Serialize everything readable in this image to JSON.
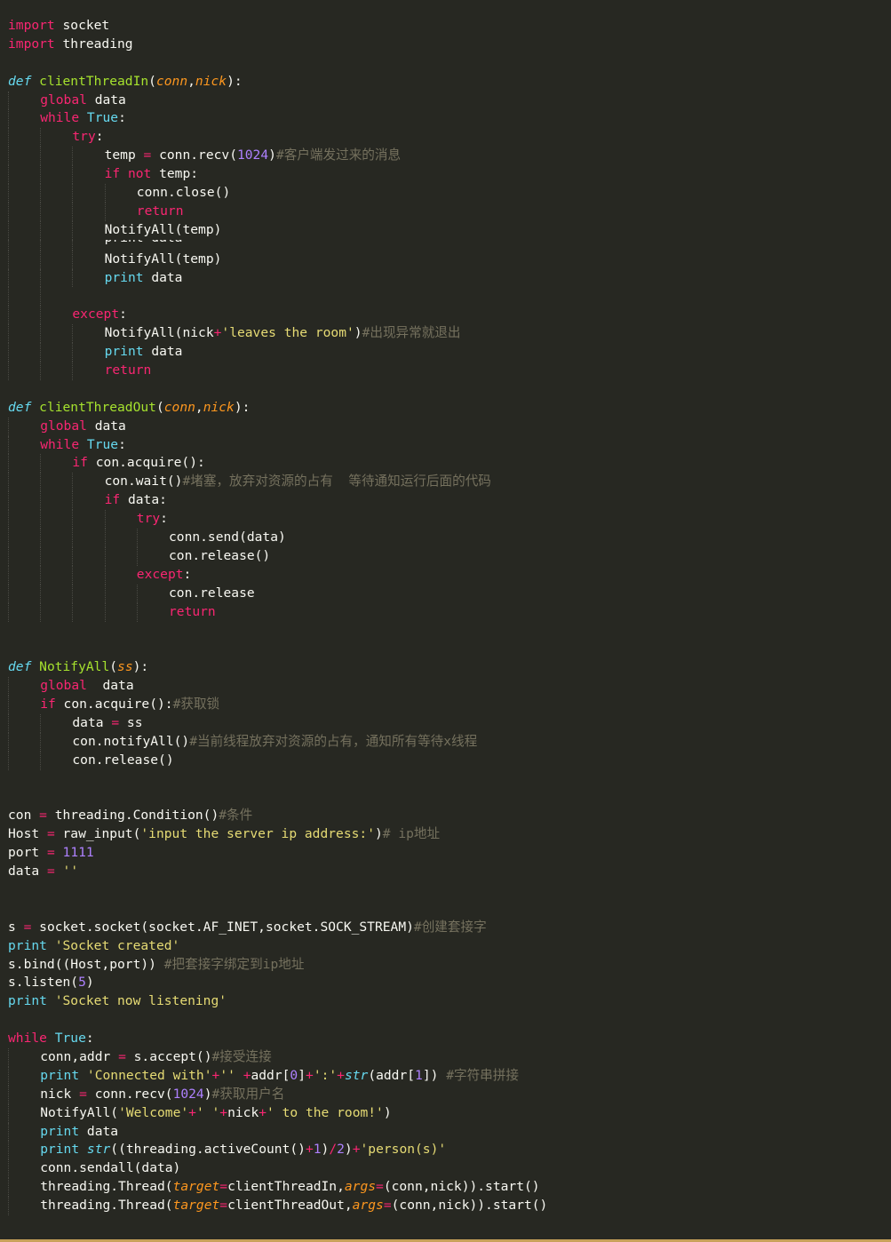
{
  "editor": {
    "theme_colors": {
      "background": "#272822",
      "keyword": "#f92672",
      "builtin": "#66d9ef",
      "function": "#a6e22e",
      "parameter": "#fd971f",
      "string": "#e6db74",
      "number": "#ae81ff",
      "comment": "#75715e",
      "text": "#f8f8f2"
    },
    "lines": [
      {
        "indent": 0,
        "tokens": [
          [
            "kw",
            "import"
          ],
          [
            "txt",
            " socket"
          ]
        ]
      },
      {
        "indent": 0,
        "tokens": [
          [
            "kw",
            "import"
          ],
          [
            "txt",
            " threading"
          ]
        ]
      },
      {
        "indent": 0,
        "tokens": []
      },
      {
        "indent": 0,
        "tokens": [
          [
            "def",
            "def"
          ],
          [
            "txt",
            " "
          ],
          [
            "fn",
            "clientThreadIn"
          ],
          [
            "txt",
            "("
          ],
          [
            "par",
            "conn"
          ],
          [
            "txt",
            ","
          ],
          [
            "par",
            "nick"
          ],
          [
            "txt",
            "):"
          ]
        ]
      },
      {
        "indent": 1,
        "tokens": [
          [
            "kw",
            "global"
          ],
          [
            "txt",
            " data"
          ]
        ]
      },
      {
        "indent": 1,
        "tokens": [
          [
            "kw",
            "while"
          ],
          [
            "txt",
            " "
          ],
          [
            "bi",
            "True"
          ],
          [
            "txt",
            ":"
          ]
        ]
      },
      {
        "indent": 2,
        "tokens": [
          [
            "kw",
            "try"
          ],
          [
            "txt",
            ":"
          ]
        ]
      },
      {
        "indent": 3,
        "tokens": [
          [
            "txt",
            "temp "
          ],
          [
            "op",
            "="
          ],
          [
            "txt",
            " conn.recv("
          ],
          [
            "num",
            "1024"
          ],
          [
            "txt",
            ")"
          ],
          [
            "com",
            "#客户端发过来的消息"
          ]
        ]
      },
      {
        "indent": 3,
        "tokens": [
          [
            "kw",
            "if"
          ],
          [
            "txt",
            " "
          ],
          [
            "kw",
            "not"
          ],
          [
            "txt",
            " temp:"
          ]
        ]
      },
      {
        "indent": 4,
        "tokens": [
          [
            "txt",
            "conn.close()"
          ]
        ]
      },
      {
        "indent": 4,
        "tokens": [
          [
            "kw",
            "return"
          ]
        ]
      },
      {
        "indent": 3,
        "tokens": [
          [
            "txt",
            "NotifyAll(temp)"
          ]
        ]
      },
      {
        "indent": 3,
        "clipped": true,
        "tokens": [
          [
            "txt",
            "print data"
          ]
        ]
      },
      {
        "indent": 3,
        "tokens": [
          [
            "txt",
            "NotifyAll(temp)"
          ]
        ]
      },
      {
        "indent": 3,
        "tokens": [
          [
            "bi",
            "print"
          ],
          [
            "txt",
            " data"
          ]
        ]
      },
      {
        "indent": 2,
        "tokens": []
      },
      {
        "indent": 2,
        "tokens": [
          [
            "kw",
            "except"
          ],
          [
            "txt",
            ":"
          ]
        ]
      },
      {
        "indent": 3,
        "tokens": [
          [
            "txt",
            "NotifyAll(nick"
          ],
          [
            "op",
            "+"
          ],
          [
            "str",
            "'leaves the room'"
          ],
          [
            "txt",
            ")"
          ],
          [
            "com",
            "#出现异常就退出"
          ]
        ]
      },
      {
        "indent": 3,
        "tokens": [
          [
            "bi",
            "print"
          ],
          [
            "txt",
            " data"
          ]
        ]
      },
      {
        "indent": 3,
        "tokens": [
          [
            "kw",
            "return"
          ]
        ]
      },
      {
        "indent": 0,
        "tokens": []
      },
      {
        "indent": 0,
        "tokens": [
          [
            "def",
            "def"
          ],
          [
            "txt",
            " "
          ],
          [
            "fn",
            "clientThreadOut"
          ],
          [
            "txt",
            "("
          ],
          [
            "par",
            "conn"
          ],
          [
            "txt",
            ","
          ],
          [
            "par",
            "nick"
          ],
          [
            "txt",
            "):"
          ]
        ]
      },
      {
        "indent": 1,
        "tokens": [
          [
            "kw",
            "global"
          ],
          [
            "txt",
            " data"
          ]
        ]
      },
      {
        "indent": 1,
        "tokens": [
          [
            "kw",
            "while"
          ],
          [
            "txt",
            " "
          ],
          [
            "bi",
            "True"
          ],
          [
            "txt",
            ":"
          ]
        ]
      },
      {
        "indent": 2,
        "tokens": [
          [
            "kw",
            "if"
          ],
          [
            "txt",
            " con.acquire():"
          ]
        ]
      },
      {
        "indent": 3,
        "tokens": [
          [
            "txt",
            "con.wait()"
          ],
          [
            "com",
            "#堵塞，放弃对资源的占有  等待通知运行后面的代码"
          ]
        ]
      },
      {
        "indent": 3,
        "tokens": [
          [
            "kw",
            "if"
          ],
          [
            "txt",
            " data:"
          ]
        ]
      },
      {
        "indent": 4,
        "tokens": [
          [
            "kw",
            "try"
          ],
          [
            "txt",
            ":"
          ]
        ]
      },
      {
        "indent": 5,
        "tokens": [
          [
            "txt",
            "conn.send(data)"
          ]
        ]
      },
      {
        "indent": 5,
        "tokens": [
          [
            "txt",
            "con.release()"
          ]
        ]
      },
      {
        "indent": 4,
        "tokens": [
          [
            "kw",
            "except"
          ],
          [
            "txt",
            ":"
          ]
        ]
      },
      {
        "indent": 5,
        "tokens": [
          [
            "txt",
            "con.release"
          ]
        ]
      },
      {
        "indent": 5,
        "tokens": [
          [
            "kw",
            "return"
          ]
        ]
      },
      {
        "indent": 0,
        "tokens": []
      },
      {
        "indent": 0,
        "tokens": []
      },
      {
        "indent": 0,
        "tokens": [
          [
            "def",
            "def"
          ],
          [
            "txt",
            " "
          ],
          [
            "fn",
            "NotifyAll"
          ],
          [
            "txt",
            "("
          ],
          [
            "par",
            "ss"
          ],
          [
            "txt",
            "):"
          ]
        ]
      },
      {
        "indent": 1,
        "tokens": [
          [
            "kw",
            "global"
          ],
          [
            "txt",
            "  data"
          ]
        ]
      },
      {
        "indent": 1,
        "tokens": [
          [
            "kw",
            "if"
          ],
          [
            "txt",
            " con.acquire():"
          ],
          [
            "com",
            "#获取锁"
          ]
        ]
      },
      {
        "indent": 2,
        "tokens": [
          [
            "txt",
            "data "
          ],
          [
            "op",
            "="
          ],
          [
            "txt",
            " ss"
          ]
        ]
      },
      {
        "indent": 2,
        "tokens": [
          [
            "txt",
            "con.notifyAll()"
          ],
          [
            "com",
            "#当前线程放弃对资源的占有，通知所有等待x线程"
          ]
        ]
      },
      {
        "indent": 2,
        "tokens": [
          [
            "txt",
            "con.release()"
          ]
        ]
      },
      {
        "indent": 0,
        "tokens": []
      },
      {
        "indent": 0,
        "tokens": []
      },
      {
        "indent": 0,
        "tokens": [
          [
            "txt",
            "con "
          ],
          [
            "op",
            "="
          ],
          [
            "txt",
            " threading.Condition()"
          ],
          [
            "com",
            "#条件"
          ]
        ]
      },
      {
        "indent": 0,
        "tokens": [
          [
            "txt",
            "Host "
          ],
          [
            "op",
            "="
          ],
          [
            "txt",
            " raw_input("
          ],
          [
            "str",
            "'input the server ip address:'"
          ],
          [
            "txt",
            ")"
          ],
          [
            "com",
            "# ip地址"
          ]
        ]
      },
      {
        "indent": 0,
        "tokens": [
          [
            "txt",
            "port "
          ],
          [
            "op",
            "="
          ],
          [
            "txt",
            " "
          ],
          [
            "num",
            "1111"
          ]
        ]
      },
      {
        "indent": 0,
        "tokens": [
          [
            "txt",
            "data "
          ],
          [
            "op",
            "="
          ],
          [
            "txt",
            " "
          ],
          [
            "str",
            "''"
          ]
        ]
      },
      {
        "indent": 0,
        "tokens": []
      },
      {
        "indent": 0,
        "tokens": []
      },
      {
        "indent": 0,
        "tokens": [
          [
            "txt",
            "s "
          ],
          [
            "op",
            "="
          ],
          [
            "txt",
            " socket.socket(socket.AF_INET,socket.SOCK_STREAM)"
          ],
          [
            "com",
            "#创建套接字"
          ]
        ]
      },
      {
        "indent": 0,
        "tokens": [
          [
            "bi",
            "print"
          ],
          [
            "txt",
            " "
          ],
          [
            "str",
            "'Socket created'"
          ]
        ]
      },
      {
        "indent": 0,
        "tokens": [
          [
            "txt",
            "s.bind((Host,port)) "
          ],
          [
            "com",
            "#把套接字绑定到ip地址"
          ]
        ]
      },
      {
        "indent": 0,
        "tokens": [
          [
            "txt",
            "s.listen("
          ],
          [
            "num",
            "5"
          ],
          [
            "txt",
            ")"
          ]
        ]
      },
      {
        "indent": 0,
        "tokens": [
          [
            "bi",
            "print"
          ],
          [
            "txt",
            " "
          ],
          [
            "str",
            "'Socket now listening'"
          ]
        ]
      },
      {
        "indent": 0,
        "tokens": []
      },
      {
        "indent": 0,
        "tokens": [
          [
            "kw",
            "while"
          ],
          [
            "txt",
            " "
          ],
          [
            "bi",
            "True"
          ],
          [
            "txt",
            ":"
          ]
        ]
      },
      {
        "indent": 1,
        "tokens": [
          [
            "txt",
            "conn,addr "
          ],
          [
            "op",
            "="
          ],
          [
            "txt",
            " s.accept()"
          ],
          [
            "com",
            "#接受连接"
          ]
        ]
      },
      {
        "indent": 1,
        "tokens": [
          [
            "bi",
            "print"
          ],
          [
            "txt",
            " "
          ],
          [
            "str",
            "'Connected with'"
          ],
          [
            "op",
            "+"
          ],
          [
            "str",
            "''"
          ],
          [
            "txt",
            " "
          ],
          [
            "op",
            "+"
          ],
          [
            "txt",
            "addr["
          ],
          [
            "num",
            "0"
          ],
          [
            "txt",
            "]"
          ],
          [
            "op",
            "+"
          ],
          [
            "str",
            "':'"
          ],
          [
            "op",
            "+"
          ],
          [
            "def",
            "str"
          ],
          [
            "txt",
            "(addr["
          ],
          [
            "num",
            "1"
          ],
          [
            "txt",
            "]) "
          ],
          [
            "com",
            "#字符串拼接"
          ]
        ]
      },
      {
        "indent": 1,
        "tokens": [
          [
            "txt",
            "nick "
          ],
          [
            "op",
            "="
          ],
          [
            "txt",
            " conn.recv("
          ],
          [
            "num",
            "1024"
          ],
          [
            "txt",
            ")"
          ],
          [
            "com",
            "#获取用户名"
          ]
        ]
      },
      {
        "indent": 1,
        "tokens": [
          [
            "txt",
            "NotifyAll("
          ],
          [
            "str",
            "'Welcome'"
          ],
          [
            "op",
            "+"
          ],
          [
            "str",
            "' '"
          ],
          [
            "op",
            "+"
          ],
          [
            "txt",
            "nick"
          ],
          [
            "op",
            "+"
          ],
          [
            "str",
            "' to the room!'"
          ],
          [
            "txt",
            ")"
          ]
        ]
      },
      {
        "indent": 1,
        "tokens": [
          [
            "bi",
            "print"
          ],
          [
            "txt",
            " data"
          ]
        ]
      },
      {
        "indent": 1,
        "tokens": [
          [
            "bi",
            "print"
          ],
          [
            "txt",
            " "
          ],
          [
            "def",
            "str"
          ],
          [
            "txt",
            "((threading.activeCount()"
          ],
          [
            "op",
            "+"
          ],
          [
            "num",
            "1"
          ],
          [
            "txt",
            ")"
          ],
          [
            "op",
            "/"
          ],
          [
            "num",
            "2"
          ],
          [
            "txt",
            ")"
          ],
          [
            "op",
            "+"
          ],
          [
            "str",
            "'person(s)'"
          ]
        ]
      },
      {
        "indent": 1,
        "tokens": [
          [
            "txt",
            "conn.sendall(data)"
          ]
        ]
      },
      {
        "indent": 1,
        "tokens": [
          [
            "txt",
            "threading.Thread("
          ],
          [
            "par",
            "target"
          ],
          [
            "op",
            "="
          ],
          [
            "txt",
            "clientThreadIn,"
          ],
          [
            "par",
            "args"
          ],
          [
            "op",
            "="
          ],
          [
            "txt",
            "(conn,nick)).start()"
          ]
        ]
      },
      {
        "indent": 1,
        "tokens": [
          [
            "txt",
            "threading.Thread("
          ],
          [
            "par",
            "target"
          ],
          [
            "op",
            "="
          ],
          [
            "txt",
            "clientThreadOut,"
          ],
          [
            "par",
            "args"
          ],
          [
            "op",
            "="
          ],
          [
            "txt",
            "(conn,nick)).start()"
          ]
        ]
      }
    ]
  }
}
